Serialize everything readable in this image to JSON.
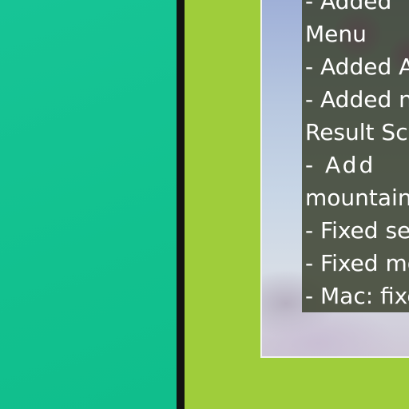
{
  "changelog": {
    "lines": [
      "- Added",
      "Menu",
      "- Added A",
      "- Added n",
      "Result Scr",
      "-        Add",
      "mountain/",
      "- Fixed sev",
      "- Fixed mo",
      "- Mac: fixe"
    ]
  },
  "colors": {
    "left_panel": "#12c18f",
    "divider": "#121212",
    "right_panel": "#9fcd3b",
    "changelog_bg": "#3c4230"
  }
}
